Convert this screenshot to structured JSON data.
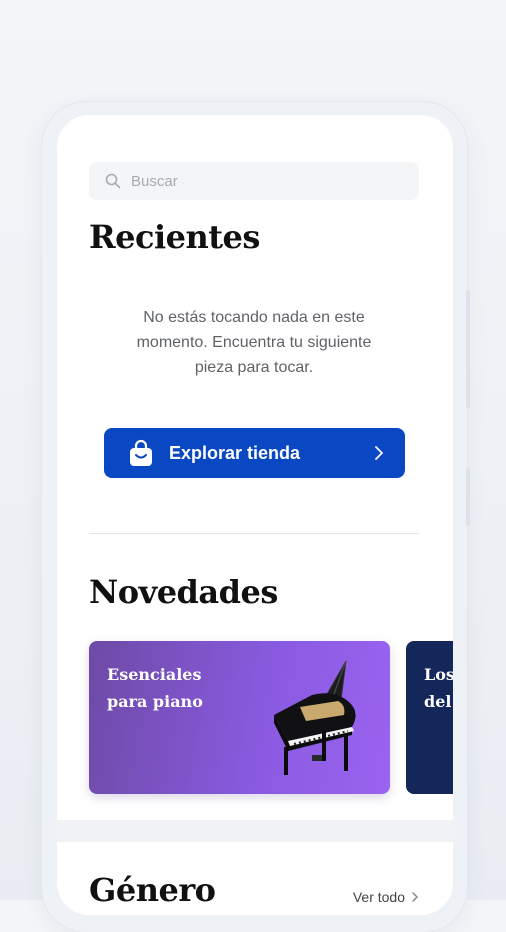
{
  "search": {
    "placeholder": "Buscar",
    "icon": "search-icon"
  },
  "recientes": {
    "title": "Recientes",
    "empty_message": "No estás tocando nada en este momento. Encuentra tu siguiente pieza para tocar.",
    "explore_button": {
      "label": "Explorar tienda",
      "icon": "shopping-bag-icon"
    }
  },
  "novedades": {
    "title": "Novedades",
    "cards": [
      {
        "title": "Esenciales\npara piano",
        "color": "#8a5be2",
        "image": "grand-piano"
      },
      {
        "title": "Los\ndel",
        "color": "#14275a"
      }
    ]
  },
  "genero": {
    "title": "Género",
    "see_all": "Ver todo"
  },
  "colors": {
    "accent": "#0a47c2",
    "background": "#ffffff"
  }
}
